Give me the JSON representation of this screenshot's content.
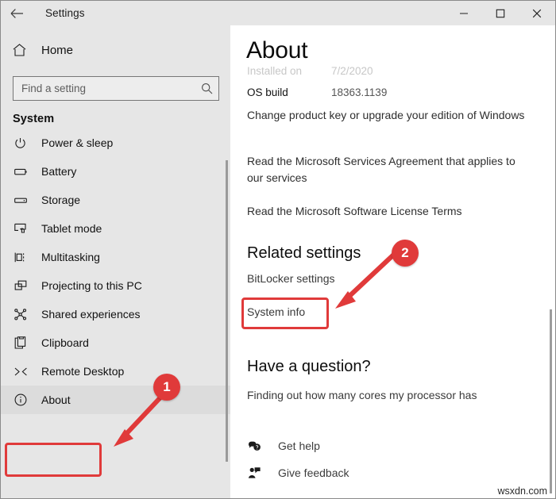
{
  "window": {
    "title": "Settings",
    "back_icon": "back-arrow-icon",
    "minimize_label": "–",
    "maximize_label": "□",
    "close_label": "✕"
  },
  "sidebar": {
    "home_label": "Home",
    "home_icon": "home-icon",
    "search": {
      "placeholder": "Find a setting",
      "value": "",
      "icon": "search-icon"
    },
    "group_title": "System",
    "items": [
      {
        "label": "Power & sleep",
        "icon": "power-icon",
        "selected": false
      },
      {
        "label": "Battery",
        "icon": "battery-icon",
        "selected": false
      },
      {
        "label": "Storage",
        "icon": "storage-icon",
        "selected": false
      },
      {
        "label": "Tablet mode",
        "icon": "tablet-icon",
        "selected": false
      },
      {
        "label": "Multitasking",
        "icon": "multitasking-icon",
        "selected": false
      },
      {
        "label": "Projecting to this PC",
        "icon": "projecting-icon",
        "selected": false
      },
      {
        "label": "Shared experiences",
        "icon": "shared-experiences-icon",
        "selected": false
      },
      {
        "label": "Clipboard",
        "icon": "clipboard-icon",
        "selected": false
      },
      {
        "label": "Remote Desktop",
        "icon": "remote-desktop-icon",
        "selected": false
      },
      {
        "label": "About",
        "icon": "info-icon",
        "selected": true
      }
    ]
  },
  "main": {
    "page_title": "About",
    "specs": [
      {
        "key": "Installed on",
        "value": "7/2/2020",
        "clipped": true
      },
      {
        "key": "OS build",
        "value": "18363.1139",
        "clipped": false
      }
    ],
    "links": [
      "Change product key or upgrade your edition of Windows",
      "Read the Microsoft Services Agreement that applies to our services",
      "Read the Microsoft Software License Terms"
    ],
    "related_settings": {
      "heading": "Related settings",
      "items": [
        "BitLocker settings",
        "System info"
      ]
    },
    "have_a_question": {
      "heading": "Have a question?",
      "link": "Finding out how many cores my processor has"
    },
    "help_rows": [
      {
        "label": "Get help",
        "icon": "get-help-icon"
      },
      {
        "label": "Give feedback",
        "icon": "give-feedback-icon"
      }
    ],
    "watermark": "wsxdn.com",
    "scrollbar": "vertical-scrollbar"
  },
  "annotations": {
    "accent_color": "#e03a3a",
    "badges": [
      {
        "number": "1",
        "target": "sidebar-item-about"
      },
      {
        "number": "2",
        "target": "related-setting-system-info"
      }
    ]
  }
}
